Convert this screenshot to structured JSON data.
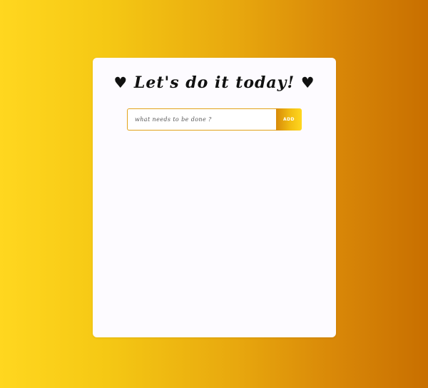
{
  "header": {
    "heart_left": "♥",
    "title": "Let's do it today!",
    "heart_right": "♥"
  },
  "form": {
    "input_value": "",
    "input_placeholder": "what needs to be done ?",
    "add_label": "ADD"
  },
  "todo_items": [],
  "colors": {
    "gradient_start": "#ffd71f",
    "gradient_end": "#c86f00",
    "card_background": "#fdfbff",
    "input_border": "#e2a21a"
  }
}
